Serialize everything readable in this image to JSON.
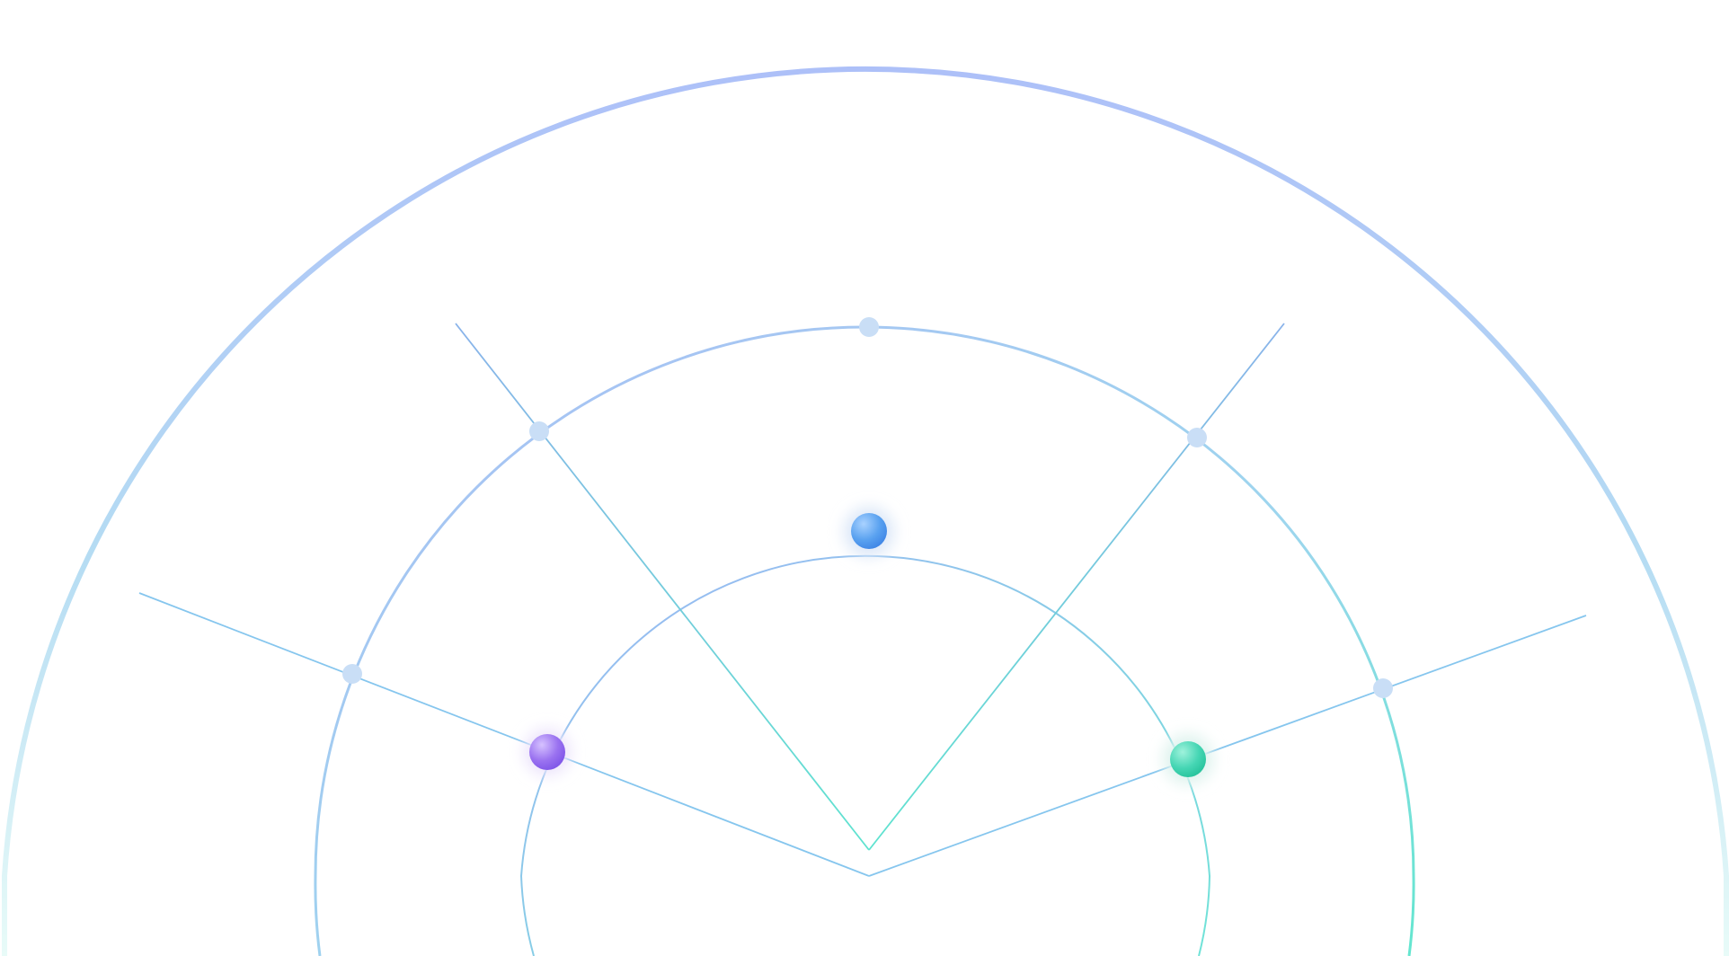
{
  "diagram": {
    "rings": [
      "outer-ring",
      "middle-ring",
      "inner-ring"
    ],
    "spokes": [
      "spoke-left-low",
      "spoke-left-high",
      "spoke-center",
      "spoke-right-high",
      "spoke-right-low"
    ],
    "nodes": [
      {
        "name": "node-center-blue",
        "color": "#5aa2f0",
        "highlight": "#a9d2ff",
        "shade": "#3f86e6"
      },
      {
        "name": "node-left-purple",
        "color": "#9a72f0",
        "highlight": "#d6c2ff",
        "shade": "#7f56e8"
      },
      {
        "name": "node-right-green",
        "color": "#46d6b4",
        "highlight": "#9ff2dc",
        "shade": "#27c39c"
      }
    ],
    "markers": [
      "marker-top",
      "marker-upper-left",
      "marker-upper-right",
      "marker-left",
      "marker-right"
    ],
    "colors": {
      "blue": "#a8c2f6",
      "cyan": "#7fdfe6",
      "teal": "#5fe6cc",
      "spoke": "#86c6ee",
      "marker": "#c9def6"
    }
  }
}
